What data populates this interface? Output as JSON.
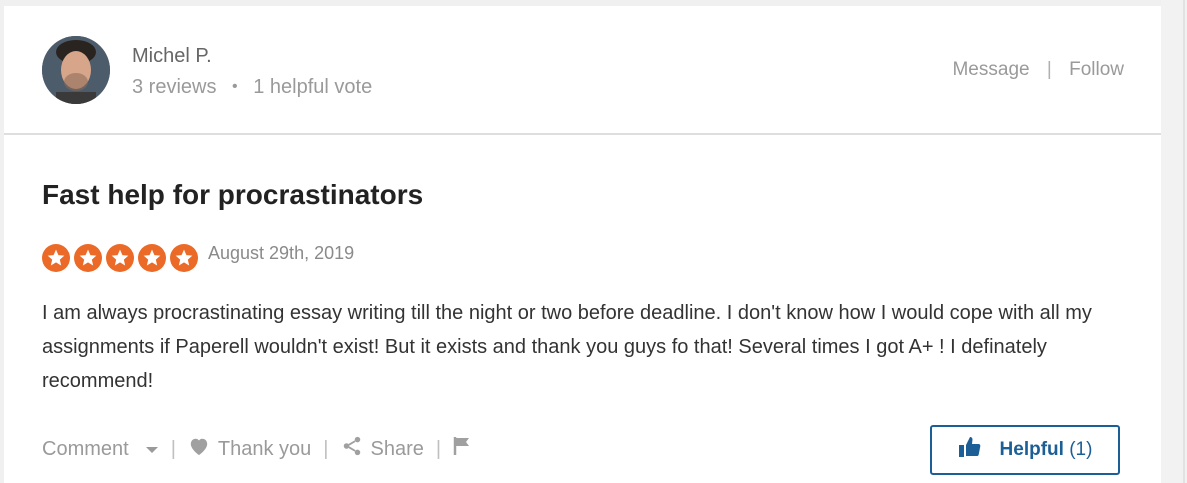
{
  "reviewer": {
    "name": "Michel P.",
    "reviews": "3 reviews",
    "helpful_votes": "1 helpful vote"
  },
  "header_actions": {
    "message": "Message",
    "separator": "|",
    "follow": "Follow"
  },
  "review": {
    "title": "Fast help for procrastinators",
    "rating": 5,
    "rating_max": 5,
    "date": "August 29th, 2019",
    "body": "I am always procrastinating essay writing till the night or two before deadline. I don't know how I would cope with all my assignments if Paperell wouldn't exist! But it exists and thank you guys fo that! Several times I got A+ ! I definately recommend!"
  },
  "footer": {
    "comment": "Comment",
    "thank_you": "Thank you",
    "share": "Share",
    "sep": "|"
  },
  "helpful_button": {
    "label": "Helpful",
    "count": "(1)"
  },
  "colors": {
    "star": "#ec6a28",
    "helpful": "#1c5f96"
  },
  "icons": [
    "chevron-down-icon",
    "heart-icon",
    "share-icon",
    "flag-icon",
    "thumbs-up-icon",
    "star-icon"
  ]
}
